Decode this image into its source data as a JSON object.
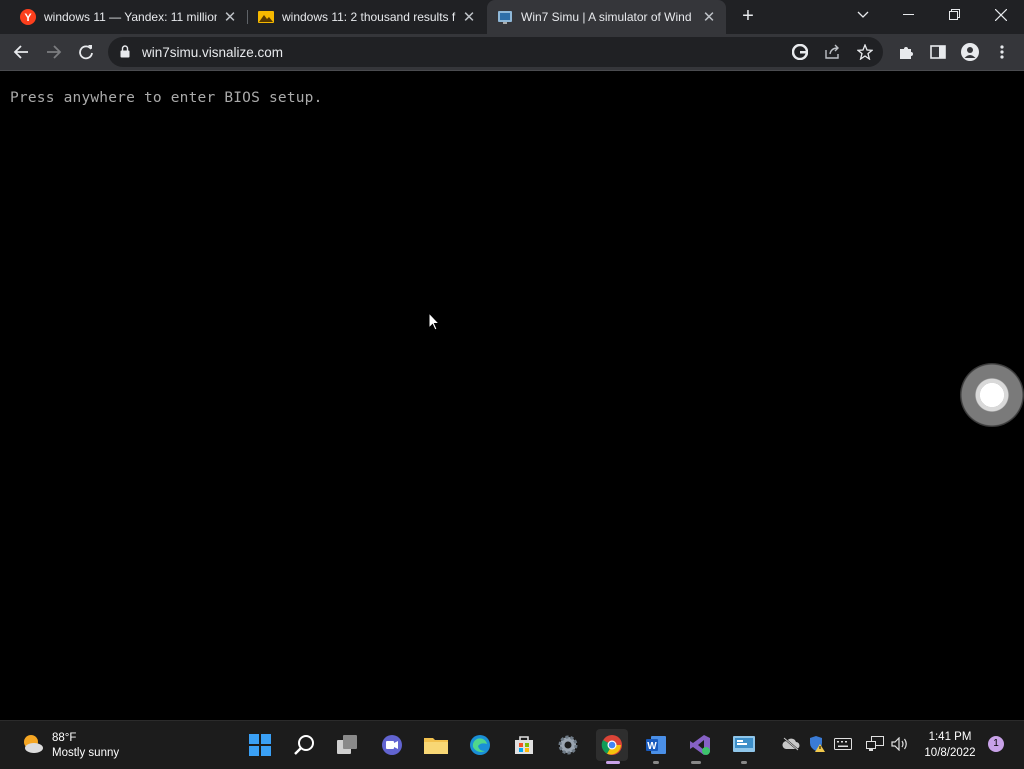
{
  "browser": {
    "tabs": [
      {
        "title": "windows 11 — Yandex: 11 million",
        "icon": "yandex-icon",
        "active": false
      },
      {
        "title": "windows 11: 2 thousand results f",
        "icon": "yandex-images-icon",
        "active": false
      },
      {
        "title": "Win7 Simu | A simulator of Wind",
        "icon": "win7simu-icon",
        "active": true
      }
    ],
    "new_tab_label": "+",
    "url": "win7simu.visnalize.com"
  },
  "page": {
    "bios_prompt": "Press anywhere to enter BIOS setup."
  },
  "taskbar": {
    "weather": {
      "temp": "88°F",
      "condition": "Mostly sunny"
    },
    "clock": {
      "time": "1:41 PM",
      "date": "10/8/2022"
    },
    "notification_count": "1"
  }
}
